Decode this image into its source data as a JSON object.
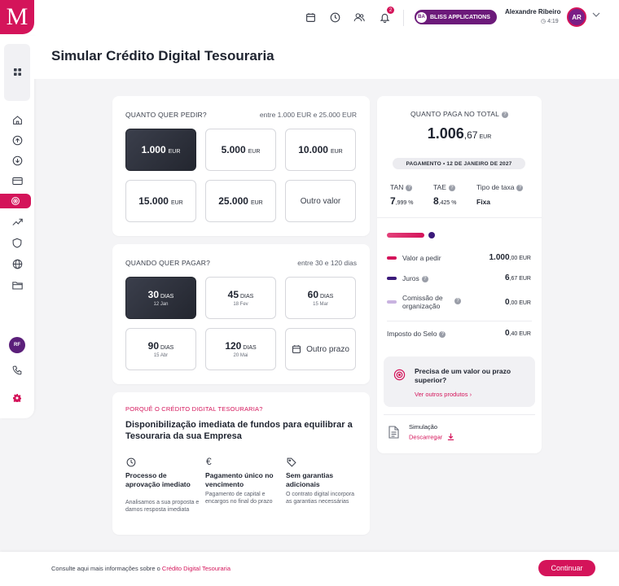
{
  "brand": {
    "logo_letter": "M",
    "accent": "#d4145a"
  },
  "topbar": {
    "notifications_count": "2",
    "bliss_initials": "BA",
    "bliss_label": "BLISS APPLICATIONS",
    "user_name": "Alexandre Ribeiro",
    "user_time": "4:19",
    "user_initials": "AR"
  },
  "sidebar": {
    "profile_initials": "RF"
  },
  "page": {
    "title": "Simular Crédito Digital Tesouraria"
  },
  "amount_section": {
    "label": "QUANTO QUER PEDIR?",
    "range": "entre 1.000 EUR e 25.000 EUR",
    "options": [
      {
        "value": "1.000",
        "unit": "EUR",
        "selected": true
      },
      {
        "value": "5.000",
        "unit": "EUR",
        "selected": false
      },
      {
        "value": "10.000",
        "unit": "EUR",
        "selected": false
      },
      {
        "value": "15.000",
        "unit": "EUR",
        "selected": false
      },
      {
        "value": "25.000",
        "unit": "EUR",
        "selected": false
      }
    ],
    "other_label": "Outro valor"
  },
  "term_section": {
    "label": "QUANDO QUER PAGAR?",
    "range": "entre 30 e 120 dias",
    "options": [
      {
        "days": "30",
        "unit": "DIAS",
        "date": "12 Jan",
        "selected": true
      },
      {
        "days": "45",
        "unit": "DIAS",
        "date": "18 Fev",
        "selected": false
      },
      {
        "days": "60",
        "unit": "DIAS",
        "date": "15 Mar",
        "selected": false
      },
      {
        "days": "90",
        "unit": "DIAS",
        "date": "15 Abr",
        "selected": false
      },
      {
        "days": "120",
        "unit": "DIAS",
        "date": "20 Mai",
        "selected": false
      }
    ],
    "other_label": "Outro prazo"
  },
  "why_section": {
    "kicker": "PORQUÊ O CRÉDITO DIGITAL TESOURARIA?",
    "title": "Disponibilização imediata de fundos para equilibrar a Tesouraria da sua Empresa",
    "features": [
      {
        "icon": "clock-icon",
        "title": "Processo de aprovação imediato",
        "desc": "Analisamos a sua proposta e damos resposta imediata"
      },
      {
        "icon": "euro-icon",
        "title": "Pagamento único no vencimento",
        "desc": "Pagamento de capital e encargos no final do prazo"
      },
      {
        "icon": "tag-icon",
        "title": "Sem garantias adicionais",
        "desc": "O contrato digital incorpora as garantias necessárias"
      }
    ]
  },
  "summary": {
    "label": "QUANTO PAGA NO TOTAL",
    "total_int": "1.006",
    "total_dec": ",67",
    "total_unit": "EUR",
    "payment_pill": "PAGAMENTO • 12 DE JANEIRO DE 2027",
    "tan_label": "TAN",
    "tan_int": "7",
    "tan_dec": ",999 %",
    "tae_label": "TAE",
    "tae_int": "8",
    "tae_dec": ",425 %",
    "rate_type_label": "Tipo de taxa",
    "rate_type_value": "Fixa",
    "breakdown": [
      {
        "label": "Valor a pedir",
        "int": "1.000",
        "dec": ",00 EUR",
        "color": "#d4145a"
      },
      {
        "label": "Juros",
        "int": "6",
        "dec": ",67 EUR",
        "color": "#3b1a7a"
      },
      {
        "label": "Comissão de organização",
        "int": "0",
        "dec": ",00 EUR",
        "color": "#c9b3e0"
      }
    ],
    "stamp_label": "Imposto do Selo",
    "stamp_int": "0",
    "stamp_dec": ",40 EUR",
    "cta_title": "Precisa de um valor ou prazo superior?",
    "cta_link": "Ver outros produtos",
    "sim_title": "Simulação",
    "sim_link": "Descarregar"
  },
  "footer": {
    "text": "Consulte aqui mais informações sobre o",
    "link": "Crédito Digital Tesouraria",
    "continue_label": "Continuar"
  }
}
